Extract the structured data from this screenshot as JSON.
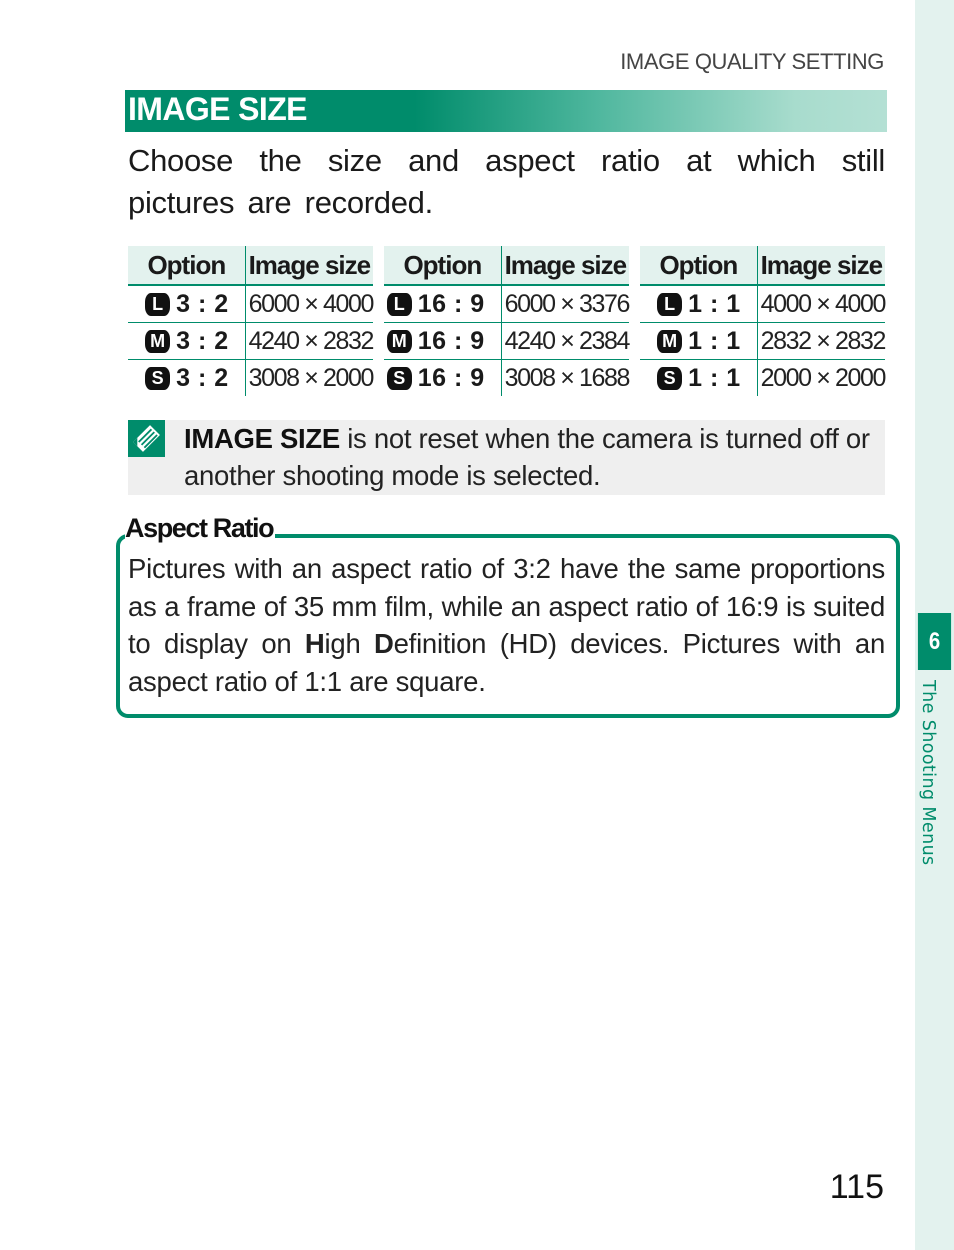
{
  "running_head": "IMAGE QUALITY SETTING",
  "section": {
    "title": "IMAGE SIZE",
    "intro": "Choose the size and aspect ratio at which still pictures are recorded."
  },
  "tables": [
    {
      "headers": [
        "Option",
        "Image size"
      ],
      "rows": [
        {
          "size_icon": "L",
          "ratio": "3 : 2",
          "image_size": "6000 × 4000"
        },
        {
          "size_icon": "M",
          "ratio": "3 : 2",
          "image_size": "4240 × 2832"
        },
        {
          "size_icon": "S",
          "ratio": "3 : 2",
          "image_size": "3008 × 2000"
        }
      ]
    },
    {
      "headers": [
        "Option",
        "Image size"
      ],
      "rows": [
        {
          "size_icon": "L",
          "ratio": "16 : 9",
          "image_size": "6000 × 3376"
        },
        {
          "size_icon": "M",
          "ratio": "16 : 9",
          "image_size": "4240 × 2384"
        },
        {
          "size_icon": "S",
          "ratio": "16 : 9",
          "image_size": "3008 × 1688"
        }
      ]
    },
    {
      "headers": [
        "Option",
        "Image size"
      ],
      "rows": [
        {
          "size_icon": "L",
          "ratio": "1 : 1",
          "image_size": "4000 × 4000"
        },
        {
          "size_icon": "M",
          "ratio": "1 : 1",
          "image_size": "2832 × 2832"
        },
        {
          "size_icon": "S",
          "ratio": "1 : 1",
          "image_size": "2000 × 2000"
        }
      ]
    }
  ],
  "note": {
    "icon": "note-icon",
    "bold": "IMAGE SIZE",
    "text": " is not reset when the camera is turned off or another shooting mode is selected."
  },
  "aspect_ratio": {
    "title": "Aspect Ratio",
    "part1": "Pictures with an aspect ratio of 3:2 have the same proportions as a frame of 35 mm film, while an aspect ratio of 16:9 is suited to display on ",
    "bold1": "H",
    "part2": "igh ",
    "bold2": "D",
    "part3": "efinition (HD) devices.  Pictures with an aspect ratio of 1:1 are square."
  },
  "sidebar": {
    "chapter_number": "6",
    "chapter_title": "The Shooting Menus"
  },
  "page_number": "115",
  "colors": {
    "accent": "#008c6b",
    "tab_bg": "#e3f2ee",
    "note_bg": "#efefef"
  }
}
